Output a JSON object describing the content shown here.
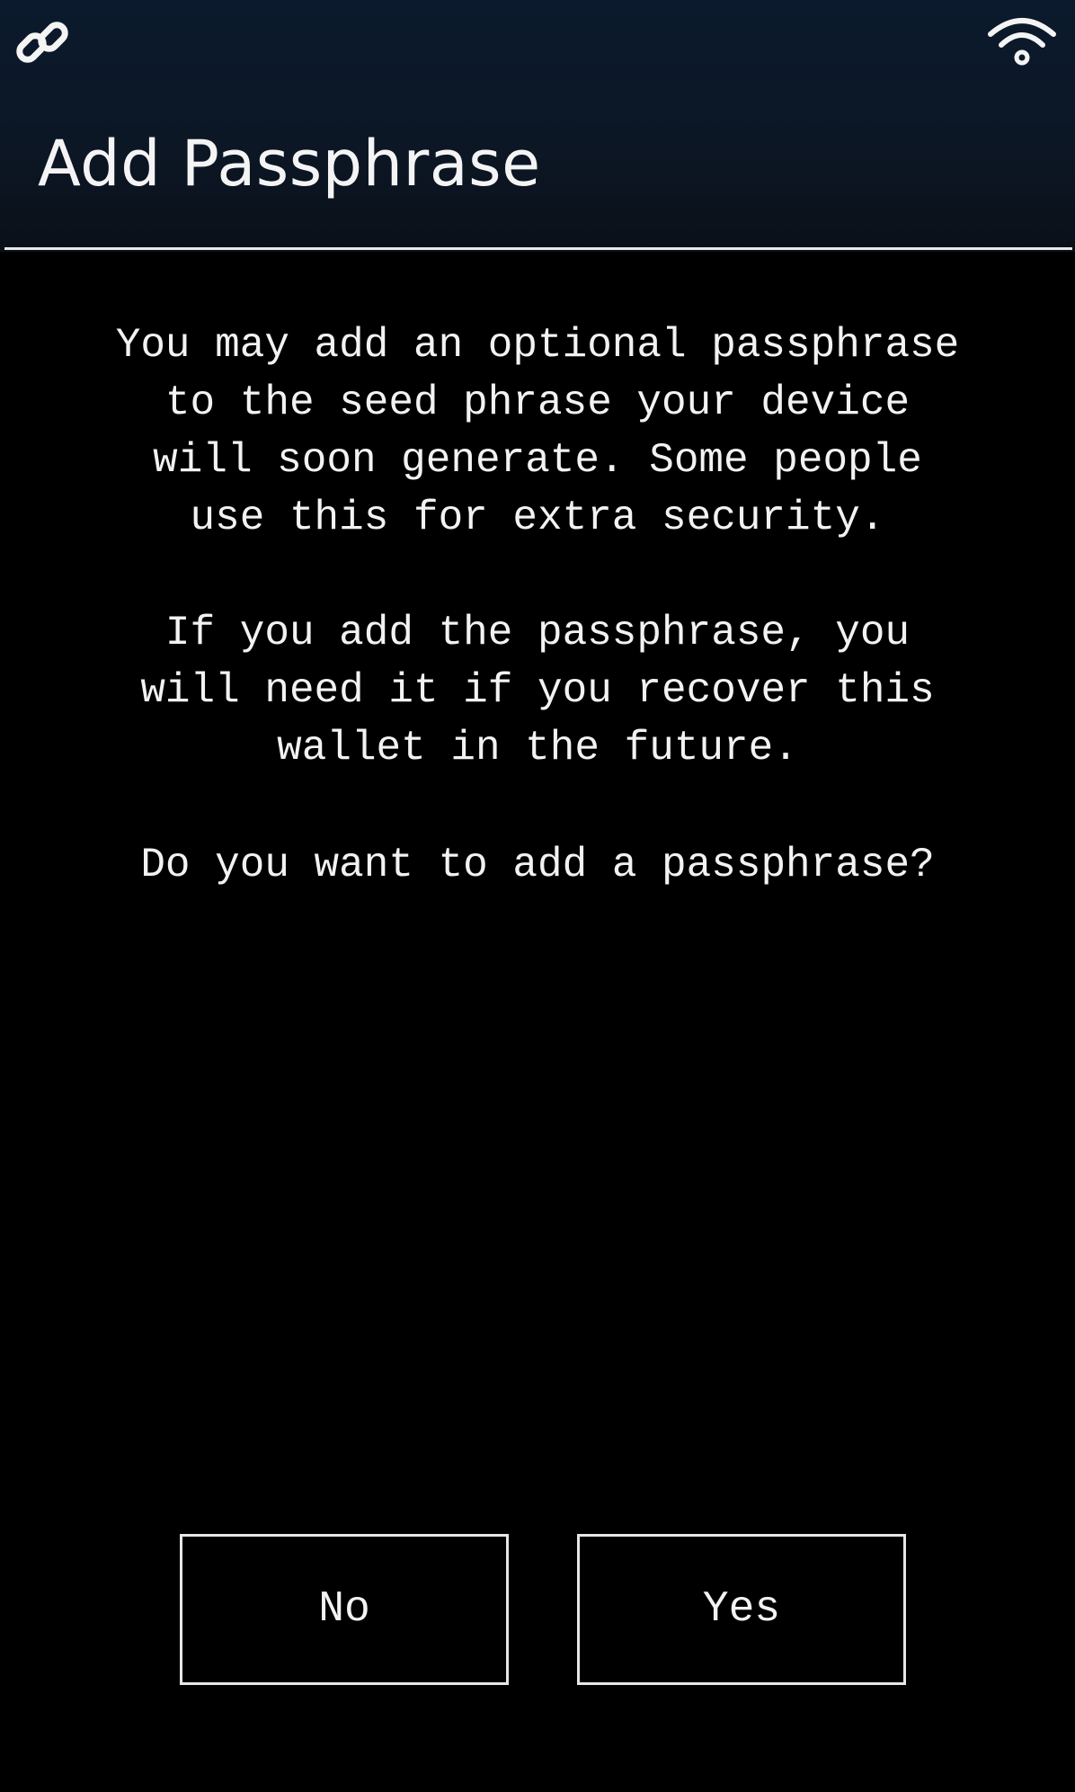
{
  "status_bar": {
    "left_icon": "link-icon",
    "right_icon": "wifi-icon"
  },
  "header": {
    "title": "Add Passphrase"
  },
  "content": {
    "paragraph_1": "You may add an optional passphrase\nto the seed phrase your device\nwill soon generate. Some people\nuse this for extra security.",
    "paragraph_2": "If you add the passphrase, you\nwill need it if you recover this\nwallet in the future.",
    "question": "Do you want to add a passphrase?"
  },
  "buttons": {
    "no_label": "No",
    "yes_label": "Yes"
  },
  "colors": {
    "background": "#000000",
    "text": "#f2f2f2",
    "header_background": "#0c1726",
    "divider": "#e8e8e8"
  }
}
